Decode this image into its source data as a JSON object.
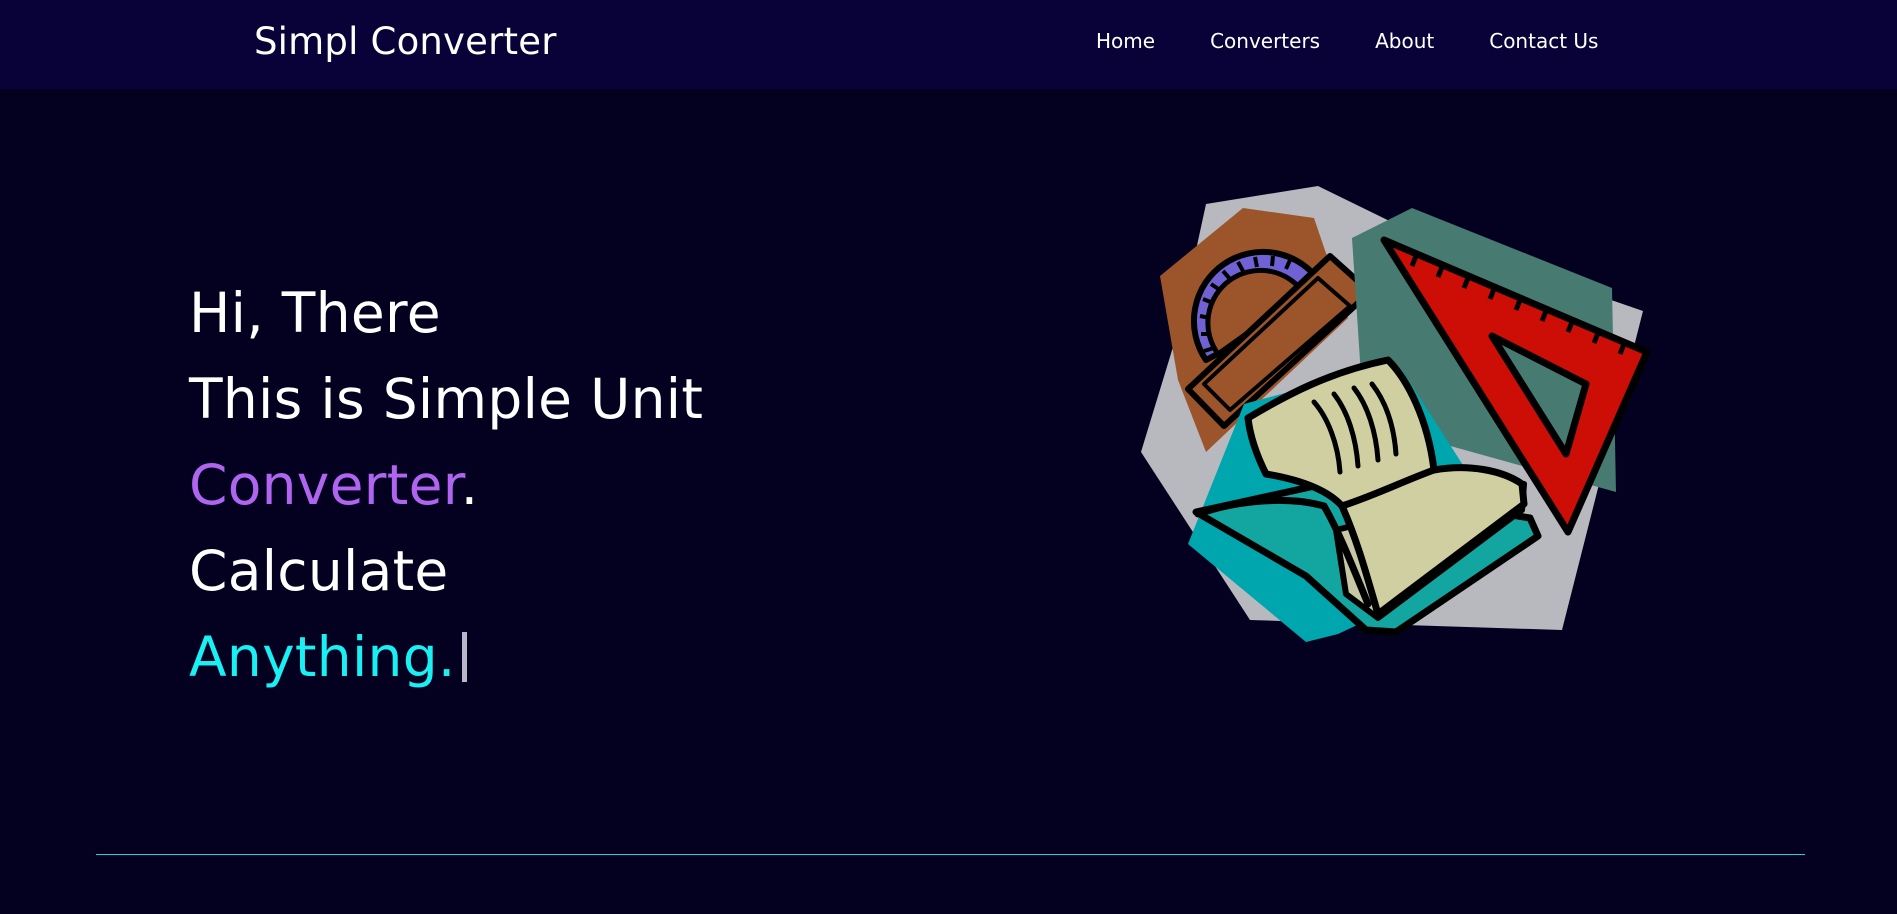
{
  "navbar": {
    "brand": "Simpl Converter",
    "links": [
      "Home",
      "Converters",
      "About",
      "Contact Us"
    ]
  },
  "hero": {
    "line1": "Hi, There",
    "line2": "This is Simple Unit",
    "line3_highlight": "Converter",
    "line3_punct": ".",
    "line4": "Calculate",
    "line5_typed": "Anything."
  },
  "illustration": {
    "icons": [
      "protractor-icon",
      "triangle-ruler-icon",
      "open-book-icon"
    ]
  },
  "colors": {
    "background": "#03011f",
    "navbar": "#080238",
    "accent_purple": "#b065f0",
    "accent_cyan": "#19f0f4",
    "divider": "#1ad3d9"
  }
}
